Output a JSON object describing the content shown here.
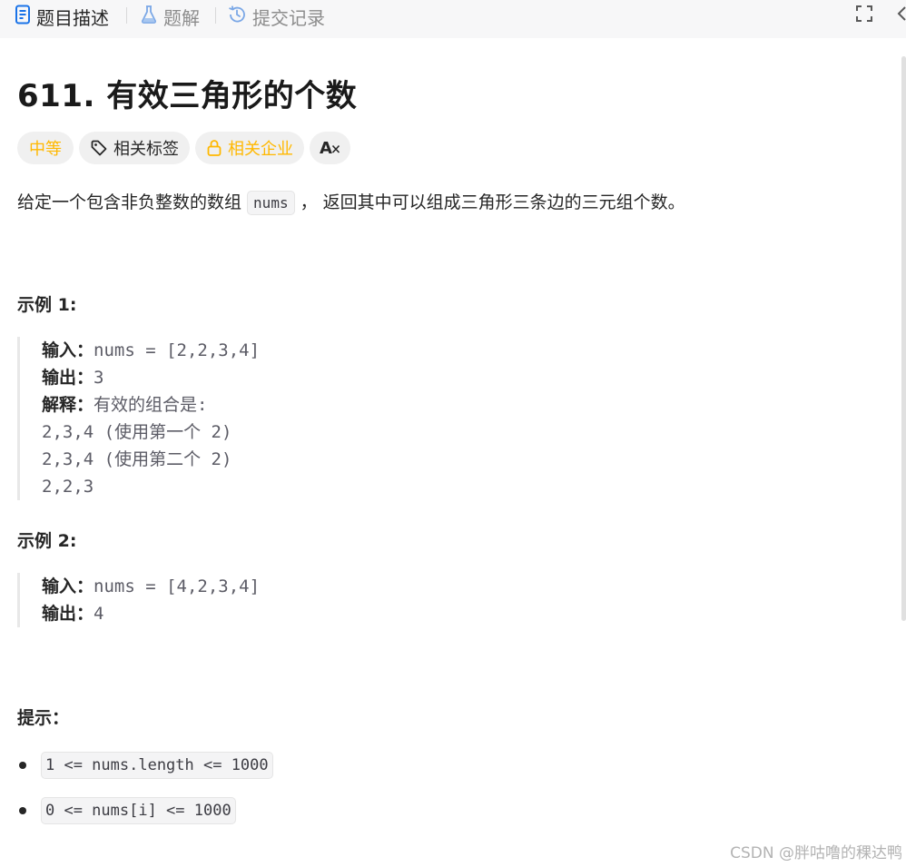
{
  "tabs": {
    "description": "题目描述",
    "solutions": "题解",
    "submissions": "提交记录"
  },
  "icons": {
    "description": "document-icon",
    "solutions": "flask-icon",
    "submissions": "history-icon",
    "fullscreen": "fullscreen-icon",
    "collapse": "chevron-left-icon",
    "tag": "tag-icon",
    "lock": "lock-icon",
    "language": "translate-icon"
  },
  "colors": {
    "medium": "#ffb800",
    "text": "#262626",
    "muted": "#5c5c66"
  },
  "problem": {
    "title": "611. 有效三角形的个数",
    "difficulty": "中等",
    "related_tags": "相关标签",
    "related_companies": "相关企业",
    "language_toggle": "A",
    "description_before": "给定一个包含非负整数的数组 ",
    "description_code": "nums",
    "description_after": " ， 返回其中可以组成三角形三条边的三元组个数。"
  },
  "examples": [
    {
      "heading": "示例 1:",
      "input_label": "输入：",
      "input_value": "nums = [2,2,3,4]",
      "output_label": "输出：",
      "output_value": "3",
      "explain_label": "解释：",
      "explain_value": "有效的组合是:",
      "extra_lines": [
        "2,3,4 (使用第一个 2)",
        "2,3,4 (使用第二个 2)",
        "2,2,3"
      ]
    },
    {
      "heading": "示例 2:",
      "input_label": "输入：",
      "input_value": "nums = [4,2,3,4]",
      "output_label": "输出：",
      "output_value": "4"
    }
  ],
  "hints": {
    "heading": "提示：",
    "constraints": [
      "1 <= nums.length <= 1000",
      "0 <= nums[i] <= 1000"
    ]
  },
  "watermark": "CSDN @胖咕噜的稞达鸭"
}
